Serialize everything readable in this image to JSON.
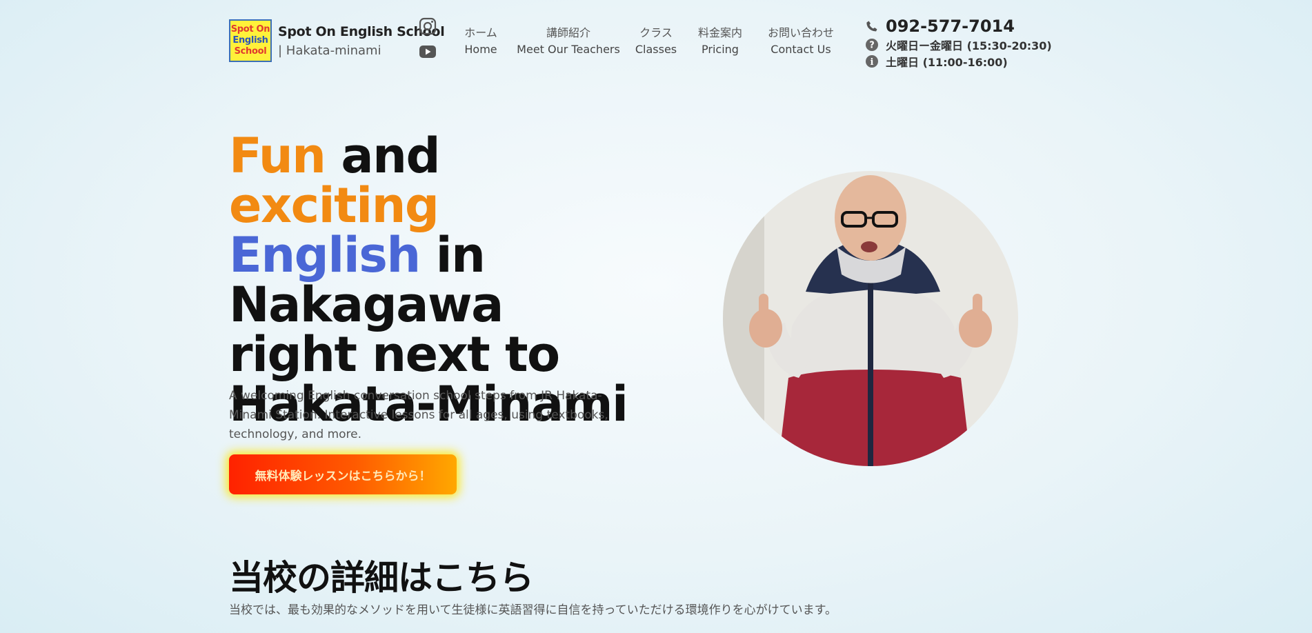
{
  "header": {
    "logo": {
      "line1": "Spot On",
      "line2": "English",
      "line3": "School"
    },
    "brand_name": "Spot On English School",
    "brand_sub": "| Hakata-minami",
    "social": {
      "instagram": "instagram-icon",
      "youtube": "youtube-icon"
    },
    "nav": [
      {
        "jp": "ホーム",
        "en": "Home"
      },
      {
        "jp": "講師紹介",
        "en": "Meet Our Teachers"
      },
      {
        "jp": "クラス",
        "en": "Classes"
      },
      {
        "jp": "料金案内",
        "en": "Pricing"
      },
      {
        "jp": "お問い合わせ",
        "en": "Contact Us"
      }
    ],
    "contact": {
      "phone": "092-577-7014",
      "hours_weekday": "火曜日ー金曜日 (15:30-20:30)",
      "hours_saturday": "土曜日 (11:00-16:00)"
    }
  },
  "hero": {
    "title_parts": [
      "Fun",
      " and ",
      "exciting",
      "English",
      " in Nakagawa right next to Hakata-Minami"
    ],
    "description": "A welcoming English conversation school steps from JR Hakata-Minami Station. Interactive lessons for all ages, using textbooks, technology, and more.",
    "cta_label": "無料体験レッスンはこちらから！"
  },
  "section": {
    "title": "当校の詳細はこちら",
    "description": "当校では、最も効果的なメソッドを用いて生徒様に英語習得に自信を持っていただける環境作りを心がけています。"
  },
  "colors": {
    "accent_orange": "#f28a12",
    "accent_blue": "#4a67d6",
    "cta_start": "#ff2200",
    "cta_end": "#ffa800"
  }
}
